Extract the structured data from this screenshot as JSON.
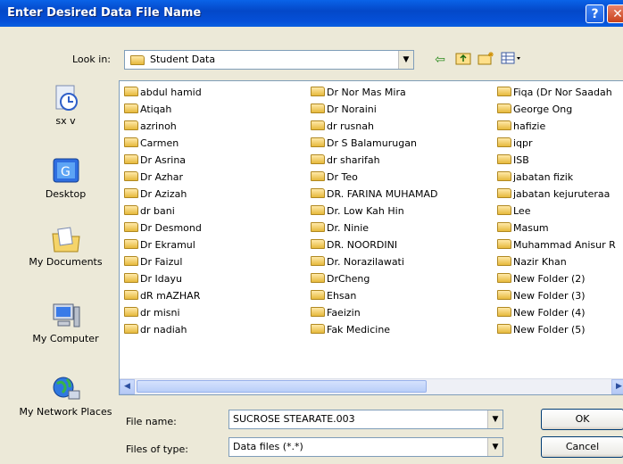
{
  "window": {
    "title": "Enter Desired Data File Name",
    "help_label": "?",
    "close_label": "✕"
  },
  "lookin": {
    "label": "Look in:",
    "value": "Student Data"
  },
  "places": [
    {
      "label": "sx v",
      "icon": "recent-icon"
    },
    {
      "label": "Desktop",
      "icon": "desktop-icon"
    },
    {
      "label": "My Documents",
      "icon": "my-documents-icon"
    },
    {
      "label": "My Computer",
      "icon": "my-computer-icon"
    },
    {
      "label": "My Network Places",
      "icon": "network-places-icon"
    }
  ],
  "columns": [
    [
      "abdul hamid",
      "Atiqah",
      "azrinoh",
      "Carmen",
      "Dr Asrina",
      "Dr Azhar",
      "Dr Azizah",
      "dr bani",
      "Dr Desmond",
      "Dr Ekramul",
      "Dr Faizul",
      "Dr Idayu",
      "dR mAZHAR",
      "dr misni",
      "dr nadiah"
    ],
    [
      "Dr Nor Mas Mira",
      "Dr Noraini",
      "dr rusnah",
      "Dr S Balamurugan",
      "dr sharifah",
      "Dr Teo",
      "DR. FARINA MUHAMAD",
      "Dr. Low Kah Hin",
      "Dr. Ninie",
      "DR. NOORDINI",
      "Dr. Norazilawati",
      "DrCheng",
      "Ehsan",
      "Faeizin",
      "Fak Medicine"
    ],
    [
      "Fiqa (Dr Nor Saadah",
      "George Ong",
      "hafizie",
      "iqpr",
      "ISB",
      "jabatan fizik",
      "jabatan kejuruteraa",
      "Lee",
      "Masum",
      "Muhammad Anisur R",
      "Nazir Khan",
      "New Folder (2)",
      "New Folder (3)",
      "New Folder (4)",
      "New Folder (5)"
    ]
  ],
  "filename": {
    "label": "File name:",
    "value": "SUCROSE STEARATE.003"
  },
  "filetype": {
    "label": "Files of type:",
    "value": "Data files (*.*)"
  },
  "buttons": {
    "ok": "OK",
    "cancel": "Cancel"
  }
}
